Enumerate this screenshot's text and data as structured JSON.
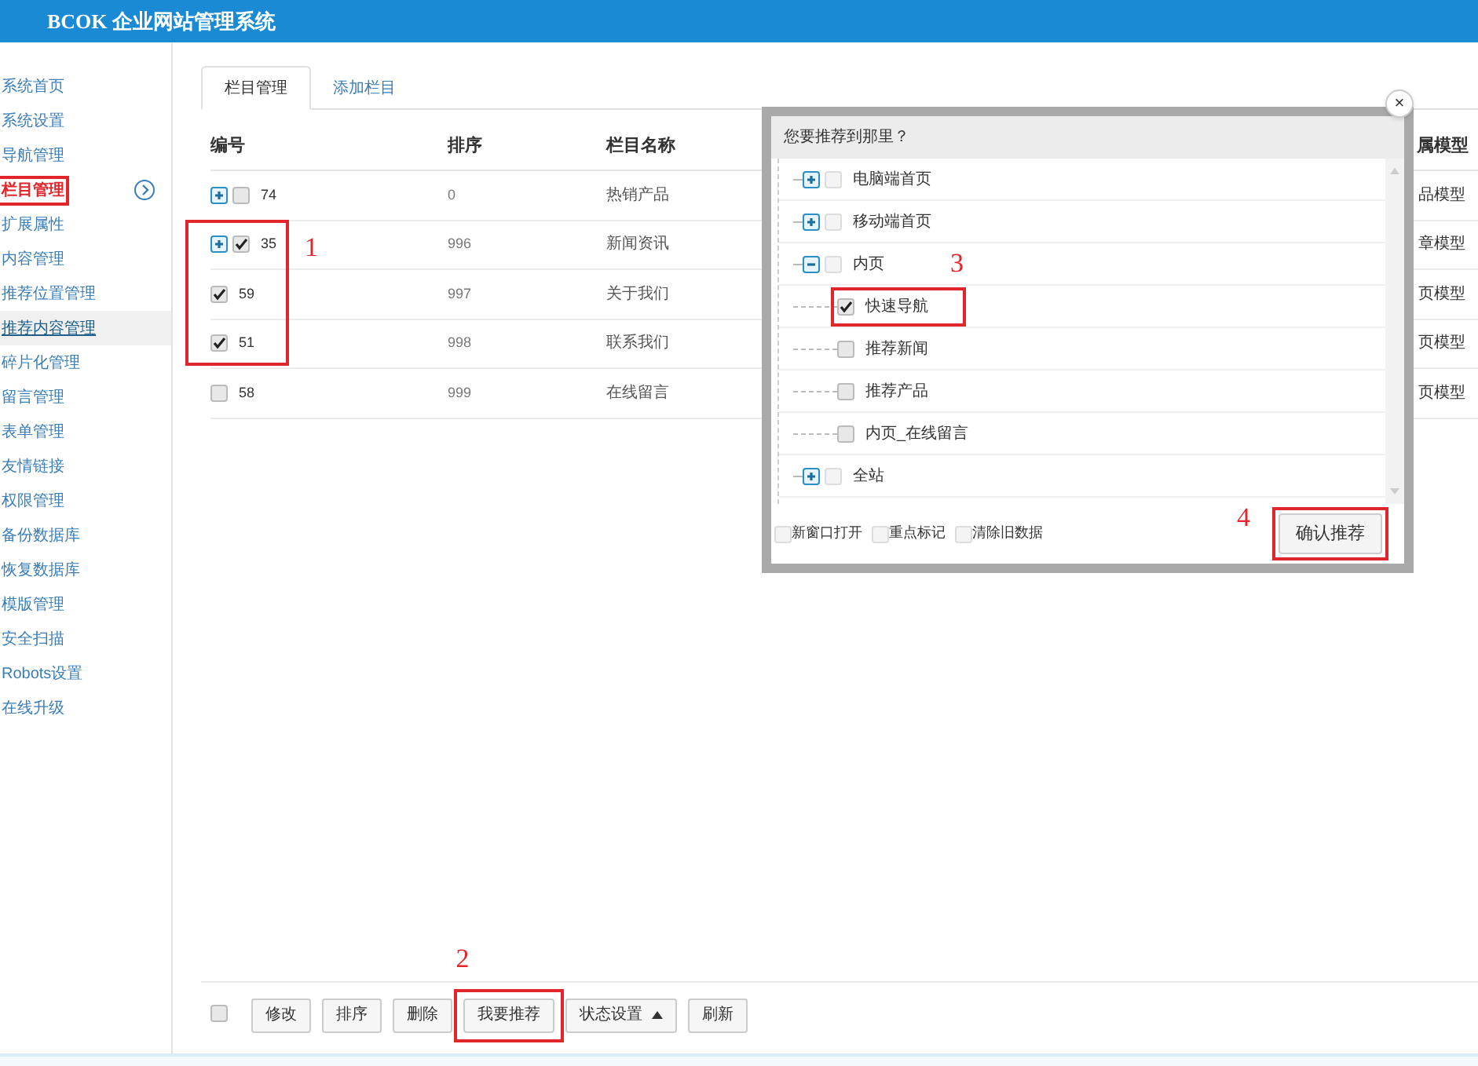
{
  "header": {
    "title": "BCOK 企业网站管理系统"
  },
  "sidebar": {
    "items": [
      {
        "label": "系统首页",
        "selected": false,
        "hovered": false
      },
      {
        "label": "系统设置",
        "selected": false,
        "hovered": false
      },
      {
        "label": "导航管理",
        "selected": false,
        "hovered": false
      },
      {
        "label": "栏目管理",
        "selected": true,
        "hovered": false
      },
      {
        "label": "扩展属性",
        "selected": false,
        "hovered": false
      },
      {
        "label": "内容管理",
        "selected": false,
        "hovered": false
      },
      {
        "label": "推荐位置管理",
        "selected": false,
        "hovered": false
      },
      {
        "label": "推荐内容管理",
        "selected": false,
        "hovered": true
      },
      {
        "label": "碎片化管理",
        "selected": false,
        "hovered": false
      },
      {
        "label": "留言管理",
        "selected": false,
        "hovered": false
      },
      {
        "label": "表单管理",
        "selected": false,
        "hovered": false
      },
      {
        "label": "友情链接",
        "selected": false,
        "hovered": false
      },
      {
        "label": "权限管理",
        "selected": false,
        "hovered": false
      },
      {
        "label": "备份数据库",
        "selected": false,
        "hovered": false
      },
      {
        "label": "恢复数据库",
        "selected": false,
        "hovered": false
      },
      {
        "label": "模版管理",
        "selected": false,
        "hovered": false
      },
      {
        "label": "安全扫描",
        "selected": false,
        "hovered": false
      },
      {
        "label": "Robots设置",
        "selected": false,
        "hovered": false
      },
      {
        "label": "在线升级",
        "selected": false,
        "hovered": false
      }
    ]
  },
  "tabs": [
    {
      "label": "栏目管理",
      "selected": true
    },
    {
      "label": "添加栏目",
      "selected": false
    }
  ],
  "table": {
    "columns": [
      "编号",
      "排序",
      "栏目名称",
      "属模型"
    ],
    "annotation": "1",
    "rows": [
      {
        "id": "74",
        "order": "0",
        "name": "热销产品",
        "model": "品模型",
        "expandable": true,
        "checked": false,
        "marked": false
      },
      {
        "id": "35",
        "order": "996",
        "name": "新闻资讯",
        "model": "章模型",
        "expandable": true,
        "checked": true,
        "marked": true
      },
      {
        "id": "59",
        "order": "997",
        "name": "关于我们",
        "model": "页模型",
        "expandable": false,
        "checked": true,
        "marked": true
      },
      {
        "id": "51",
        "order": "998",
        "name": "联系我们",
        "model": "页模型",
        "expandable": false,
        "checked": true,
        "marked": true
      },
      {
        "id": "58",
        "order": "999",
        "name": "在线留言",
        "model": "页模型",
        "expandable": false,
        "checked": false,
        "marked": false
      }
    ]
  },
  "toolbar": {
    "select_all": {
      "checked": false
    },
    "annotation": "2",
    "buttons": [
      {
        "label": "修改",
        "kind": "button",
        "marked": false
      },
      {
        "label": "排序",
        "kind": "button",
        "marked": false
      },
      {
        "label": "删除",
        "kind": "button",
        "marked": false
      },
      {
        "label": "我要推荐",
        "kind": "button",
        "marked": true
      },
      {
        "label": "状态设置",
        "kind": "dropdown",
        "marked": false
      },
      {
        "label": "刷新",
        "kind": "button",
        "marked": false
      }
    ]
  },
  "dialog": {
    "title": "您要推荐到那里？",
    "close": "×",
    "annotation": "3",
    "tree": [
      {
        "label": "电脑端首页",
        "expandable": true,
        "expanded": false,
        "checked": false,
        "marked": false
      },
      {
        "label": "移动端首页",
        "expandable": true,
        "expanded": false,
        "checked": false,
        "marked": false
      },
      {
        "label": "内页",
        "expandable": true,
        "expanded": true,
        "checked": false,
        "marked": false,
        "children": [
          {
            "label": "快速导航",
            "expandable": false,
            "checked": true,
            "marked": true
          },
          {
            "label": "推荐新闻",
            "expandable": false,
            "checked": false,
            "marked": false
          },
          {
            "label": "推荐产品",
            "expandable": false,
            "checked": false,
            "marked": false
          },
          {
            "label": "内页_在线留言",
            "expandable": false,
            "checked": false,
            "marked": false
          }
        ]
      },
      {
        "label": "全站",
        "expandable": true,
        "expanded": false,
        "checked": false,
        "marked": false
      }
    ],
    "options": [
      {
        "label": "新窗口打开",
        "checked": false
      },
      {
        "label": "重点标记",
        "checked": false
      },
      {
        "label": "清除旧数据",
        "checked": false
      }
    ],
    "confirm": {
      "label": "确认推荐",
      "marked": true,
      "annotation": "4"
    }
  }
}
